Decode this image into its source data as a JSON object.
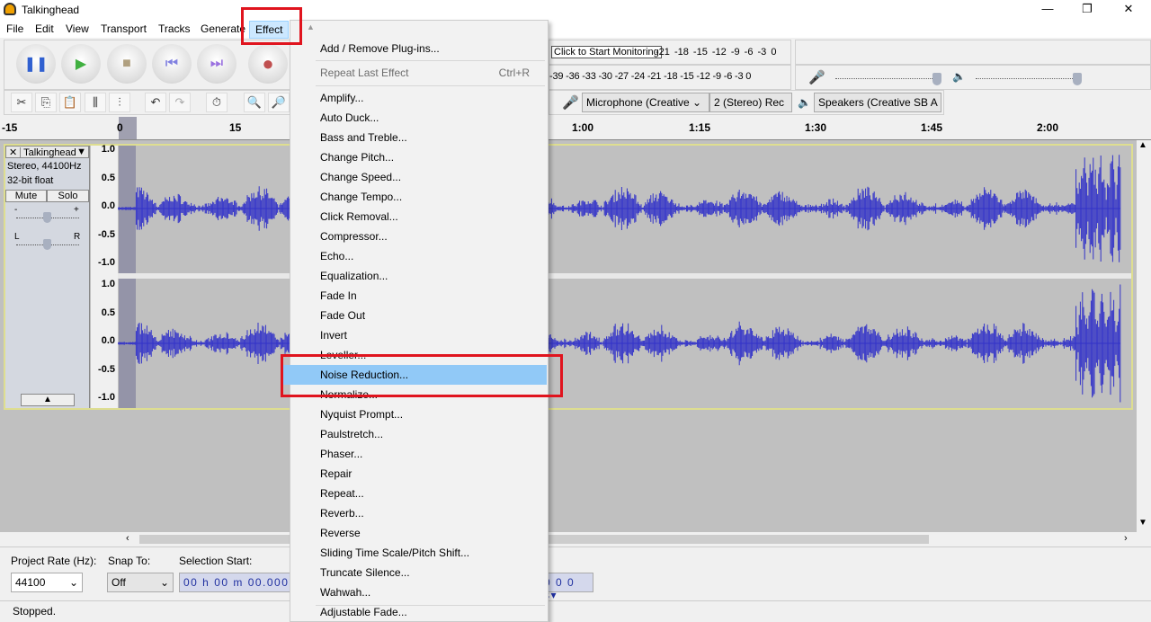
{
  "window": {
    "title": "Talkinghead",
    "minimize": "—",
    "maximize": "❐",
    "close": "✕"
  },
  "menubar": [
    "File",
    "Edit",
    "View",
    "Transport",
    "Tracks",
    "Generate",
    "Effect"
  ],
  "transport": {
    "buttons": [
      "pause",
      "play",
      "stop",
      "skip-start",
      "skip-end",
      "record"
    ]
  },
  "meters": {
    "monitor_label": "Click to Start Monitoring",
    "rec_scale": "-21 -18 -15 -12 -9 -6 -3 0",
    "play_scale": "-39 -36 -33 -30 -27 -24 -21 -18 -15 -12 -9 -6 -3 0"
  },
  "devices": {
    "input": "Microphone (Creative",
    "channels": "2 (Stereo) Rec",
    "output": "Speakers (Creative SB A"
  },
  "ruler": [
    "-15",
    "0",
    "15",
    "1:00",
    "1:15",
    "1:30",
    "1:45",
    "2:00"
  ],
  "track": {
    "name": "Talkinghead",
    "info1": "Stereo, 44100Hz",
    "info2": "32-bit float",
    "mute": "Mute",
    "solo": "Solo",
    "gain_minus": "-",
    "gain_plus": "+",
    "pan_l": "L",
    "pan_r": "R",
    "yaxis": [
      "1.0",
      "0.5",
      "0.0",
      "-0.5",
      "-1.0"
    ],
    "color": "#3232c8"
  },
  "effect_menu": {
    "items": [
      {
        "label": "Add / Remove Plug-ins..."
      },
      {
        "label": "Repeat Last Effect",
        "shortcut": "Ctrl+R",
        "disabled": true
      },
      {
        "label": "Amplify..."
      },
      {
        "label": "Auto Duck..."
      },
      {
        "label": "Bass and Treble..."
      },
      {
        "label": "Change Pitch..."
      },
      {
        "label": "Change Speed..."
      },
      {
        "label": "Change Tempo..."
      },
      {
        "label": "Click Removal..."
      },
      {
        "label": "Compressor..."
      },
      {
        "label": "Echo..."
      },
      {
        "label": "Equalization..."
      },
      {
        "label": "Fade In"
      },
      {
        "label": "Fade Out"
      },
      {
        "label": "Invert"
      },
      {
        "label": "Leveller..."
      },
      {
        "label": "Noise Reduction...",
        "highlighted": true
      },
      {
        "label": "Normalize..."
      },
      {
        "label": "Nyquist Prompt..."
      },
      {
        "label": "Paulstretch..."
      },
      {
        "label": "Phaser..."
      },
      {
        "label": "Repair"
      },
      {
        "label": "Repeat..."
      },
      {
        "label": "Reverb..."
      },
      {
        "label": "Reverse"
      },
      {
        "label": "Sliding Time Scale/Pitch Shift..."
      },
      {
        "label": "Truncate Silence..."
      },
      {
        "label": "Wahwah..."
      },
      {
        "label": "Adjustable Fade..."
      }
    ]
  },
  "selection": {
    "rate_label": "Project Rate (Hz):",
    "rate": "44100",
    "snap_label": "Snap To:",
    "snap": "Off",
    "start_label": "Selection Start:",
    "start": "00 h 00 m 00.000",
    "end_tail": "0 0 0 s"
  },
  "status": "Stopped."
}
